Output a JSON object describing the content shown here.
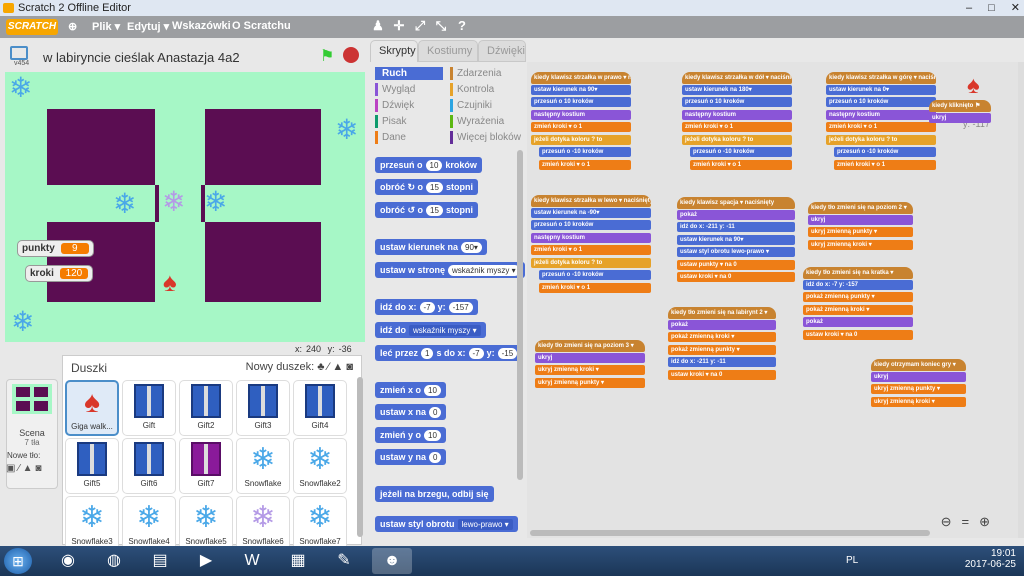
{
  "window": {
    "title": "Scratch 2 Offline Editor",
    "controls": [
      "–",
      "□",
      "✕"
    ]
  },
  "menubar": {
    "logo": "SCRATCH",
    "items": [
      "Plik ▾",
      "Edytuj ▾",
      "Wskazówki",
      "O Scratchu"
    ]
  },
  "stage_header": {
    "title": "w labiryncie cieślak Anastazja 4a2",
    "version": "v454"
  },
  "watchers": [
    {
      "label": "punkty",
      "value": "9"
    },
    {
      "label": "kroki",
      "value": "120"
    }
  ],
  "coords": {
    "x_label": "x:",
    "x": "240",
    "y_label": "y:",
    "y": "-36"
  },
  "sprites_panel": {
    "title": "Duszki",
    "new_sprite": "Nowy duszek:",
    "stage_label": "Scena",
    "stage_backdrops": "7 tła",
    "new_backdrop": "Nowe tło:",
    "sprites": [
      "Giga walk...",
      "Gift",
      "Gift2",
      "Gift3",
      "Gift4",
      "Gift5",
      "Gift6",
      "Gift7",
      "Snowflake",
      "Snowflake2",
      "Snowflake3",
      "Snowflake4",
      "Snowflake5",
      "Snowflake6",
      "Snowflake7"
    ]
  },
  "tabs": [
    "Skrypty",
    "Kostiumy",
    "Dźwięki"
  ],
  "categories": [
    {
      "label": "Ruch",
      "color": "#4a6cd4"
    },
    {
      "label": "Zdarzenia",
      "color": "#c88330"
    },
    {
      "label": "Wygląd",
      "color": "#8a55d7"
    },
    {
      "label": "Kontrola",
      "color": "#e6a229"
    },
    {
      "label": "Dźwięk",
      "color": "#bb42c3"
    },
    {
      "label": "Czujniki",
      "color": "#2ca5e2"
    },
    {
      "label": "Pisak",
      "color": "#0e9a6c"
    },
    {
      "label": "Wyrażenia",
      "color": "#5cb712"
    },
    {
      "label": "Dane",
      "color": "#ee7d16"
    },
    {
      "label": "Więcej bloków",
      "color": "#632d99"
    }
  ],
  "palette_blocks": {
    "move": {
      "a": "przesuń o",
      "v": "10",
      "b": "kroków"
    },
    "turn_r": {
      "a": "obróć ↻ o",
      "v": "15",
      "b": "stopni"
    },
    "turn_l": {
      "a": "obróć ↺ o",
      "v": "15",
      "b": "stopni"
    },
    "point_dir": {
      "a": "ustaw kierunek na",
      "v": "90▾"
    },
    "point_towards": {
      "a": "ustaw w stronę",
      "v": "wskaźnik myszy ▾"
    },
    "goto_xy": {
      "a": "idź do x:",
      "x": "-7",
      "b": "y:",
      "y": "-157"
    },
    "goto": {
      "a": "idź do",
      "v": "wskaźnik myszy ▾"
    },
    "glide": {
      "a": "leć przez",
      "s": "1",
      "b": "s do x:",
      "x": "-7",
      "c": "y:",
      "y": "-15"
    },
    "change_x": {
      "a": "zmień x o",
      "v": "10"
    },
    "set_x": {
      "a": "ustaw x na",
      "v": "0"
    },
    "change_y": {
      "a": "zmień y o",
      "v": "10"
    },
    "set_y": {
      "a": "ustaw y na",
      "v": "0"
    },
    "bounce": {
      "a": "jeżeli na brzegu, odbij się"
    },
    "rotation": {
      "a": "ustaw styl obrotu",
      "v": "lewo-prawo ▾"
    }
  },
  "scripts": {
    "s1": [
      "kiedy klawisz strzałka w prawo ▾ naciśnięty",
      "ustaw kierunek na 90▾",
      "przesuń o 10 kroków",
      "następny kostium",
      "zmień kroki ▾ o 1",
      "jeżeli dotyka koloru ? to",
      "przesuń o -10 kroków",
      "zmień kroki ▾ o 1"
    ],
    "s2": [
      "kiedy klawisz strzałka w dół ▾ naciśnięty",
      "ustaw kierunek na 180▾",
      "przesuń o 10 kroków",
      "następny kostium",
      "zmień kroki ▾ o 1",
      "jeżeli dotyka koloru ? to",
      "przesuń o -10 kroków",
      "zmień kroki ▾ o 1"
    ],
    "s3": [
      "kiedy klawisz strzałka w górę ▾ naciśnięty",
      "ustaw kierunek na 0▾",
      "przesuń o 10 kroków",
      "następny kostium",
      "zmień kroki ▾ o 1",
      "jeżeli dotyka koloru ? to",
      "przesuń o -10 kroków",
      "zmień kroki ▾ o 1"
    ],
    "s4": [
      "kiedy kliknięto ⚑",
      "ukryj"
    ],
    "s4_coord": "y: -117",
    "s5": [
      "kiedy klawisz strzałka w lewo ▾ naciśnięty",
      "ustaw kierunek na -90▾",
      "przesuń o 10 kroków",
      "następny kostium",
      "zmień kroki ▾ o 1",
      "jeżeli dotyka koloru ? to",
      "przesuń o -10 kroków",
      "zmień kroki ▾ o 1"
    ],
    "s6": [
      "kiedy klawisz spacja ▾ naciśnięty",
      "pokaż",
      "idź do x: -211 y: -11",
      "ustaw kierunek na 90▾",
      "ustaw styl obrotu lewo-prawo ▾",
      "ustaw punkty ▾ na 0",
      "ustaw kroki ▾ na 0"
    ],
    "s7": [
      "kiedy tło zmieni się na poziom 2 ▾",
      "ukryj",
      "ukryj zmienną punkty ▾",
      "ukryj zmienną kroki ▾"
    ],
    "s8": [
      "kiedy tło zmieni się na kratka ▾",
      "idź do x: -7 y: -157",
      "pokaż zmienną punkty ▾",
      "pokaż zmienną kroki ▾",
      "pokaż",
      "ustaw kroki ▾ na 0"
    ],
    "s9": [
      "kiedy tło zmieni się na labirynt 2 ▾",
      "pokaż",
      "pokaż zmienną kroki ▾",
      "pokaż zmienną punkty ▾",
      "idź do x: -211 y: -11",
      "ustaw kroki ▾ na 0"
    ],
    "s10": [
      "kiedy tło zmieni się na poziom 3 ▾",
      "ukryj",
      "ukryj zmienną kroki ▾",
      "ukryj zmienną punkty ▾"
    ],
    "s11": [
      "kiedy otrzymam koniec gry ▾",
      "ukryj",
      "ukryj zmienną punkty ▾",
      "ukryj zmienną kroki ▾"
    ]
  },
  "zoom": {
    "out": "⊖",
    "reset": "=",
    "in": "⊕"
  },
  "tray": {
    "lang": "PL",
    "time": "19:01",
    "date": "2017-06-25"
  }
}
